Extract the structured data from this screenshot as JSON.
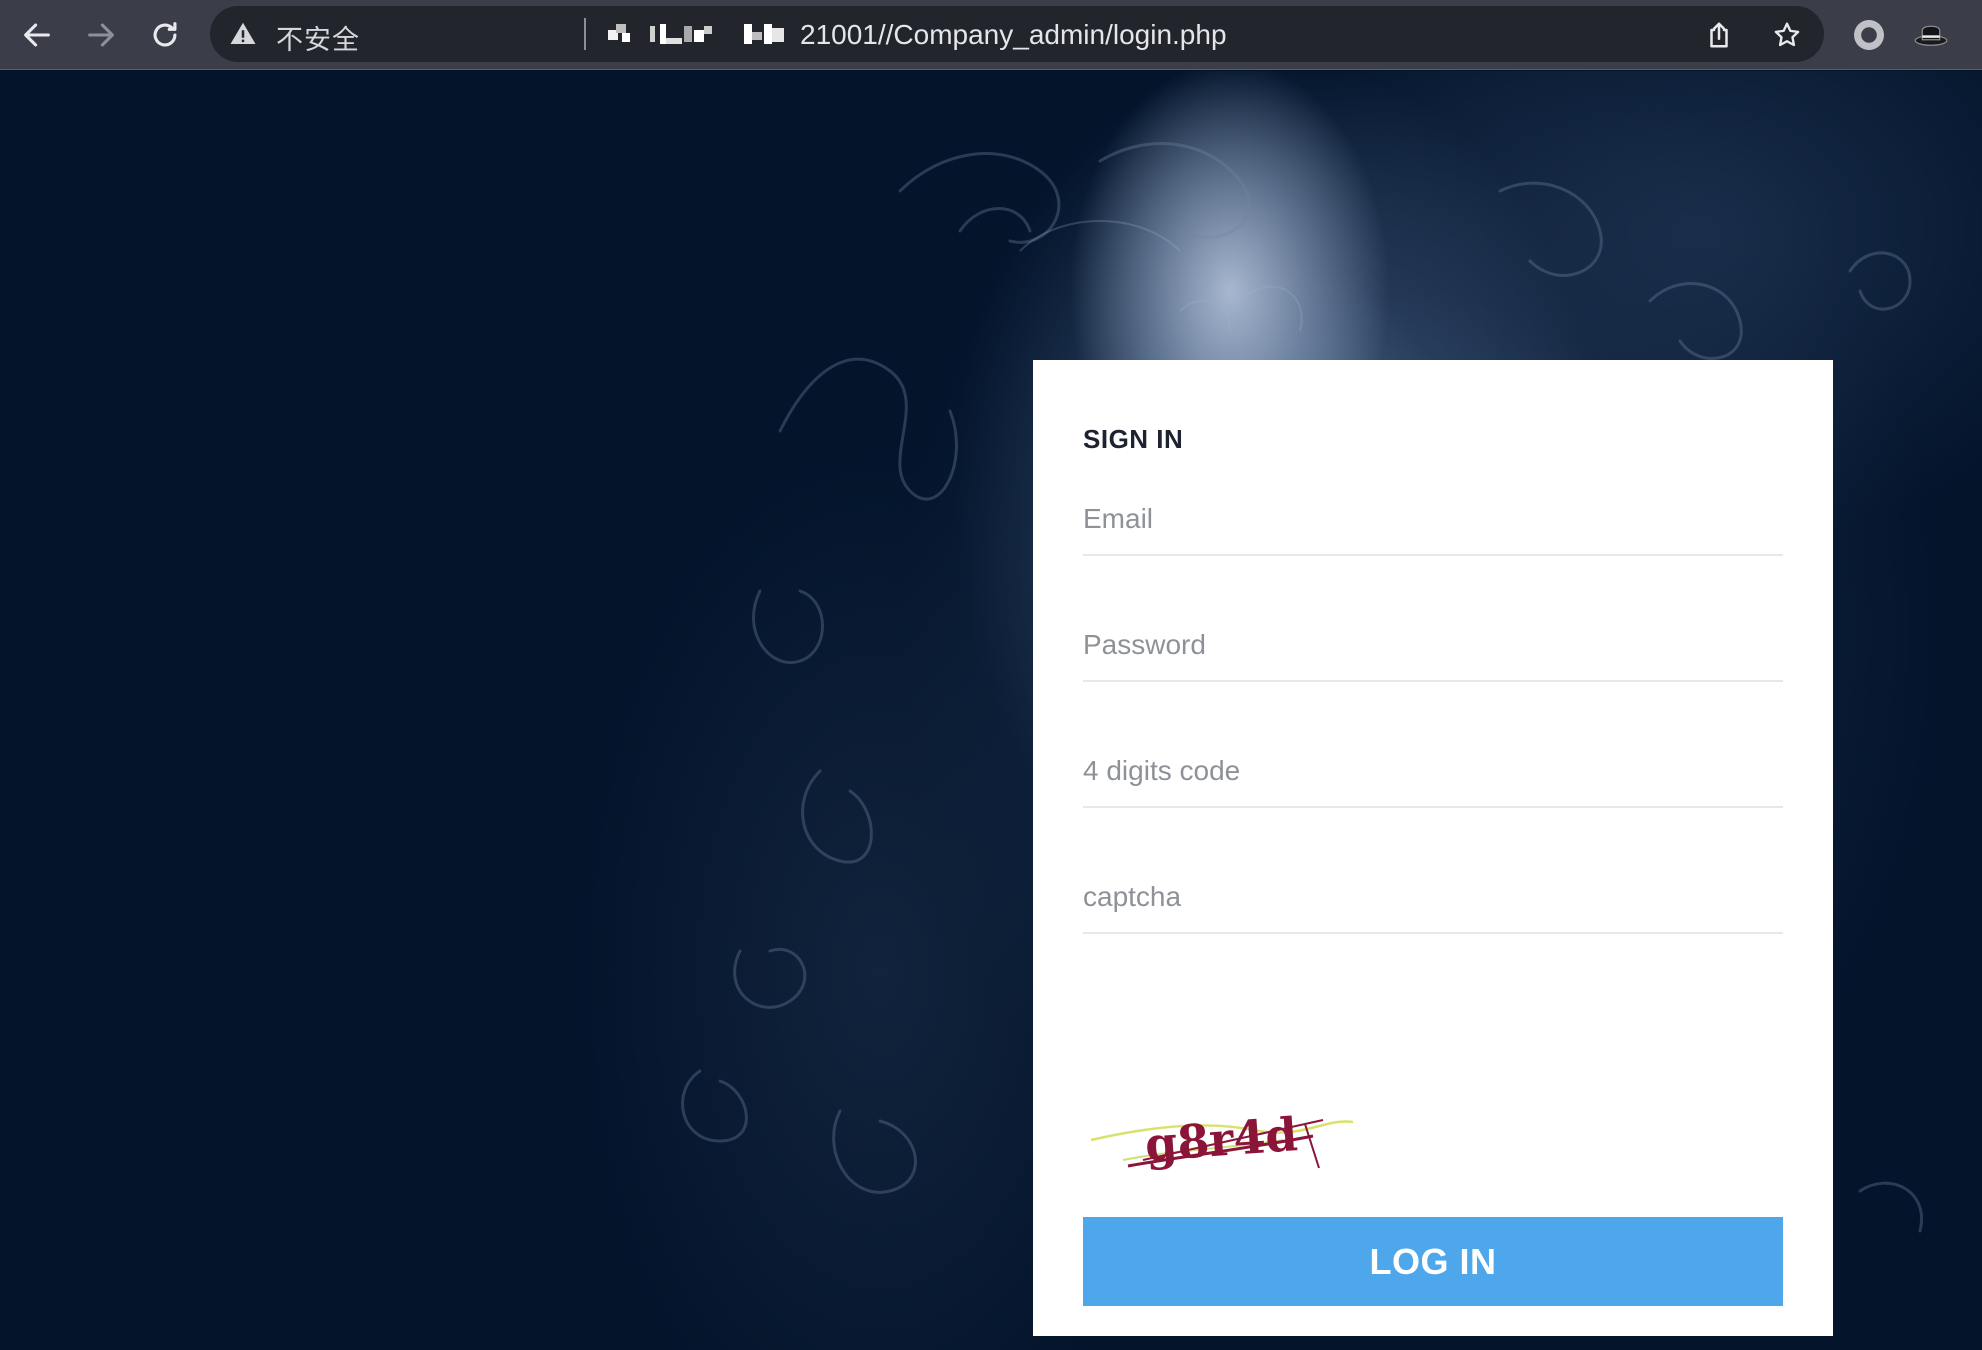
{
  "browser": {
    "security_label": "不安全",
    "url": "21001//Company_admin/login.php",
    "icons": {
      "back": "back-arrow-icon",
      "forward": "forward-arrow-icon",
      "reload": "reload-icon",
      "warning": "warning-triangle-icon",
      "share": "share-icon",
      "bookmark": "star-icon",
      "extension_record": "record-extension-icon",
      "extension_hat": "hat-extension-icon"
    }
  },
  "login": {
    "title": "SIGN IN",
    "email_placeholder": "Email",
    "password_placeholder": "Password",
    "code_placeholder": "4 digits code",
    "captcha_placeholder": "captcha",
    "captcha_text": "g8r4d",
    "submit_label": "LOG IN"
  },
  "colors": {
    "page_background": "#03142b",
    "button": "#4ea7ea",
    "card": "#ffffff",
    "toolbar": "#3b3e48"
  }
}
